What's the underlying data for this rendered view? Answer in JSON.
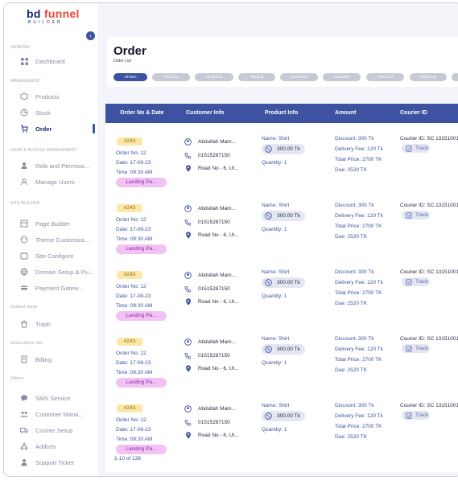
{
  "brand": {
    "word1": "bd",
    "word2": "funnel",
    "word3": "BUILDER"
  },
  "sidebar": {
    "sections": [
      "GENERAL",
      "MANAGEMENT",
      "USER & ACCESS MANAGEMENT",
      "SITE BUILDER",
      "Deleted items",
      "Subscription Info",
      "Others"
    ],
    "items": [
      {
        "label": "Dashboard",
        "icon": "grid-icon"
      },
      {
        "label": "Products",
        "icon": "box-icon"
      },
      {
        "label": "Stock",
        "icon": "stock-icon"
      },
      {
        "label": "Order",
        "icon": "cart-icon"
      },
      {
        "label": "Role and Permissi...",
        "icon": "user-key-icon"
      },
      {
        "label": "Manage Users",
        "icon": "users-icon"
      },
      {
        "label": "Page Builder",
        "icon": "page-icon"
      },
      {
        "label": "Theme Customiza...",
        "icon": "palette-icon"
      },
      {
        "label": "Site Configure",
        "icon": "config-icon"
      },
      {
        "label": "Domain Setup & Pu...",
        "icon": "globe-icon"
      },
      {
        "label": "Payment Gatew...",
        "icon": "card-icon"
      },
      {
        "label": "Trash",
        "icon": "trash-icon"
      },
      {
        "label": "Billing",
        "icon": "billing-icon"
      },
      {
        "label": "SMS Service",
        "icon": "sms-icon"
      },
      {
        "label": "Customer Mana...",
        "icon": "customers-icon"
      },
      {
        "label": "Courier Setup",
        "icon": "truck-icon"
      },
      {
        "label": "Addons",
        "icon": "addons-icon"
      },
      {
        "label": "Support Ticket",
        "icon": "support-icon"
      }
    ]
  },
  "page": {
    "title": "Order",
    "subtitle": "Order List"
  },
  "tabs": [
    "All Item",
    "Pending",
    "Confirmed",
    "Shipped",
    "Delivered",
    "Cancelled",
    "Returned",
    "Follow Up",
    "Ho"
  ],
  "table": {
    "headers": [
      "Order No & Date",
      "Customer Info",
      "Product Info",
      "Amount",
      "Courier ID"
    ],
    "rows": [
      {
        "badge": "#243",
        "order_no": "Order No: 12",
        "date": "Date: 17-08-23",
        "time": "Time: 09:30 AM",
        "source": "Landing Pa...",
        "name": "Abdullah Mam...",
        "phone": "01515287150",
        "address": "Road No - 6, Ut...",
        "product": "Name: Shirt",
        "price": "300.00 Tk",
        "qty": "Quantity: 1",
        "discount": "Discount: 300 Tk",
        "delivery": "Delivery Fee: 120 Tk",
        "total": "Total Price: 2700 TK",
        "due": "Due: 2520 TK",
        "courier": "Courier ID: SC 13151001",
        "track": "Track"
      },
      {
        "badge": "#243",
        "order_no": "Order No: 12",
        "date": "Date: 17-08-23",
        "time": "Time: 09:30 AM",
        "source": "Landing Pa...",
        "name": "Abdullah Mam...",
        "phone": "01515287150",
        "address": "Road No - 6, Ut...",
        "product": "Name: Shirt",
        "price": "300.00 Tk",
        "qty": "Quantity: 1",
        "discount": "Discount: 300 Tk",
        "delivery": "Delivery Fee: 120 Tk",
        "total": "Total Price: 2700 TK",
        "due": "Due: 2520 TK",
        "courier": "Courier ID: SC 13151001",
        "track": "Track"
      },
      {
        "badge": "#243",
        "order_no": "Order No: 12",
        "date": "Date: 17-08-23",
        "time": "Time: 09:30 AM",
        "source": "Landing Pa...",
        "name": "Abdullah Mam...",
        "phone": "01515287150",
        "address": "Road No - 6, Ut...",
        "product": "Name: Shirt",
        "price": "300.00 Tk",
        "qty": "Quantity: 1",
        "discount": "Discount: 300 Tk",
        "delivery": "Delivery Fee: 120 Tk",
        "total": "Total Price: 2700 TK",
        "due": "Due: 2520 TK",
        "courier": "Courier ID: SC 13151001",
        "track": "Track"
      },
      {
        "badge": "#243",
        "order_no": "Order No: 12",
        "date": "Date: 17-08-23",
        "time": "Time: 09:30 AM",
        "source": "Landing Pa...",
        "name": "Abdullah Mam...",
        "phone": "01515287150",
        "address": "Road No - 6, Ut...",
        "product": "Name: Shirt",
        "price": "300.00 Tk",
        "qty": "Quantity: 1",
        "discount": "Discount: 300 Tk",
        "delivery": "Delivery Fee: 120 Tk",
        "total": "Total Price: 2700 TK",
        "due": "Due: 2520 TK",
        "courier": "Courier ID: SC 13151001",
        "track": "Track"
      },
      {
        "badge": "#243",
        "order_no": "Order No: 12",
        "date": "Date: 17-08-23",
        "time": "Time: 09:30 AM",
        "source": "Landing Pa...",
        "name": "Abdullah Mam...",
        "phone": "01515287150",
        "address": "Road No - 6, Ut...",
        "product": "Name: Shirt",
        "price": "300.00 Tk",
        "qty": "Quantity: 1",
        "discount": "Discount: 300 Tk",
        "delivery": "Delivery Fee: 120 Tk",
        "total": "Total Price: 2700 TK",
        "due": "Due: 2520 TK",
        "courier": "Courier ID: SC 13151001",
        "track": "Track"
      }
    ]
  },
  "pagination": "1-10 of 138",
  "colors": {
    "primary": "#3d52a0",
    "badge": "#fde7a8",
    "landing": "#f2c2f5",
    "logo_accent": "#e8473c"
  }
}
